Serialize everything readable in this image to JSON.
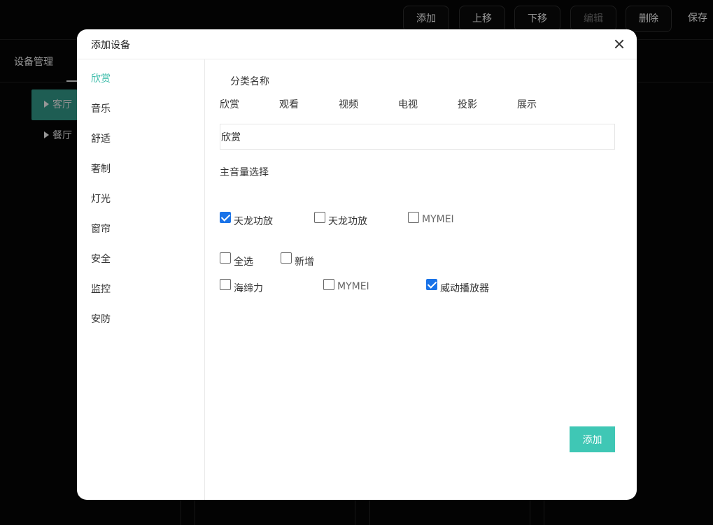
{
  "toolbar": {
    "add": "添加",
    "move_up": "上移",
    "move_down": "下移",
    "edit": "编辑",
    "delete": "删除",
    "save": "保存"
  },
  "background": {
    "title": "设备管理",
    "rooms": [
      "客厅",
      "餐厅"
    ]
  },
  "dialog": {
    "title": "添加设备",
    "sidebar": [
      "欣赏",
      "音乐",
      "舒适",
      "奢制",
      "灯光",
      "窗帘",
      "安全",
      "监控",
      "安防"
    ],
    "category_label": "分类名称",
    "tags": [
      "欣赏",
      "观看",
      "视频",
      "电视",
      "投影",
      "展示"
    ],
    "name_value": "欣赏",
    "volume_label": "主音量选择",
    "volume_options": [
      {
        "label": "天龙功放",
        "checked": true
      },
      {
        "label": "天龙功放",
        "checked": false
      },
      {
        "label": "MYMEI",
        "checked": false
      }
    ],
    "select_all": "全选",
    "new_item": "新增",
    "devices": [
      {
        "label": "海缔力",
        "checked": false
      },
      {
        "label": "MYMEI",
        "checked": false
      },
      {
        "label": "威动播放器",
        "checked": true
      }
    ],
    "add_button": "添加"
  },
  "colors": {
    "accent": "#3fc7b5",
    "active_room": "#2e8f80",
    "checkbox": "#1a73e8"
  }
}
